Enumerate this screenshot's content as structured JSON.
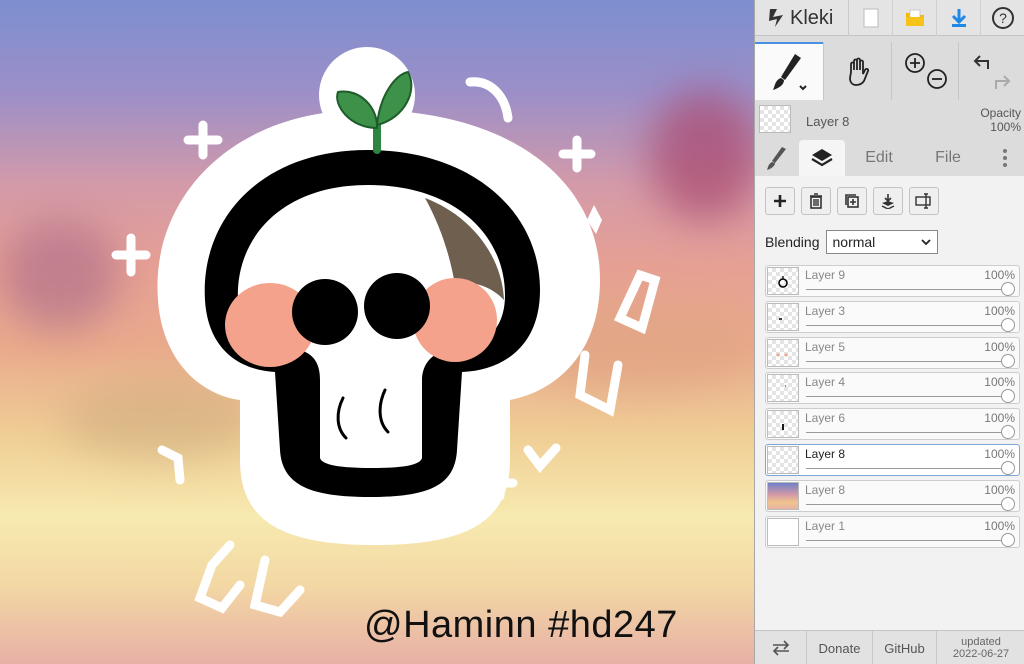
{
  "canvas": {
    "watermark": "@Haminn #hd247"
  },
  "app": {
    "name": "Kleki"
  },
  "toolbar": {
    "new-icon": "new-file-icon",
    "open-icon": "open-folder-icon",
    "download-icon": "download-icon",
    "help-icon": "help-icon"
  },
  "current_layer": {
    "name": "Layer 8",
    "opacity_label": "Opacity",
    "opacity_value": "100%"
  },
  "tabs": {
    "edit": "Edit",
    "file": "File"
  },
  "blending": {
    "label": "Blending",
    "value": "normal"
  },
  "layers": [
    {
      "name": "Layer 9",
      "opacity": "100%"
    },
    {
      "name": "Layer 3",
      "opacity": "100%"
    },
    {
      "name": "Layer 5",
      "opacity": "100%"
    },
    {
      "name": "Layer 4",
      "opacity": "100%"
    },
    {
      "name": "Layer 6",
      "opacity": "100%"
    },
    {
      "name": "Layer 8",
      "opacity": "100%",
      "active": true
    },
    {
      "name": "Layer 8",
      "opacity": "100%"
    },
    {
      "name": "Layer 1",
      "opacity": "100%"
    }
  ],
  "footer": {
    "donate": "Donate",
    "github": "GitHub",
    "updated_label": "updated",
    "updated_date": "2022-06-27"
  },
  "colors": {
    "accent": "#4a90e2",
    "download": "#1e88e5",
    "folder": "#f2b800"
  }
}
